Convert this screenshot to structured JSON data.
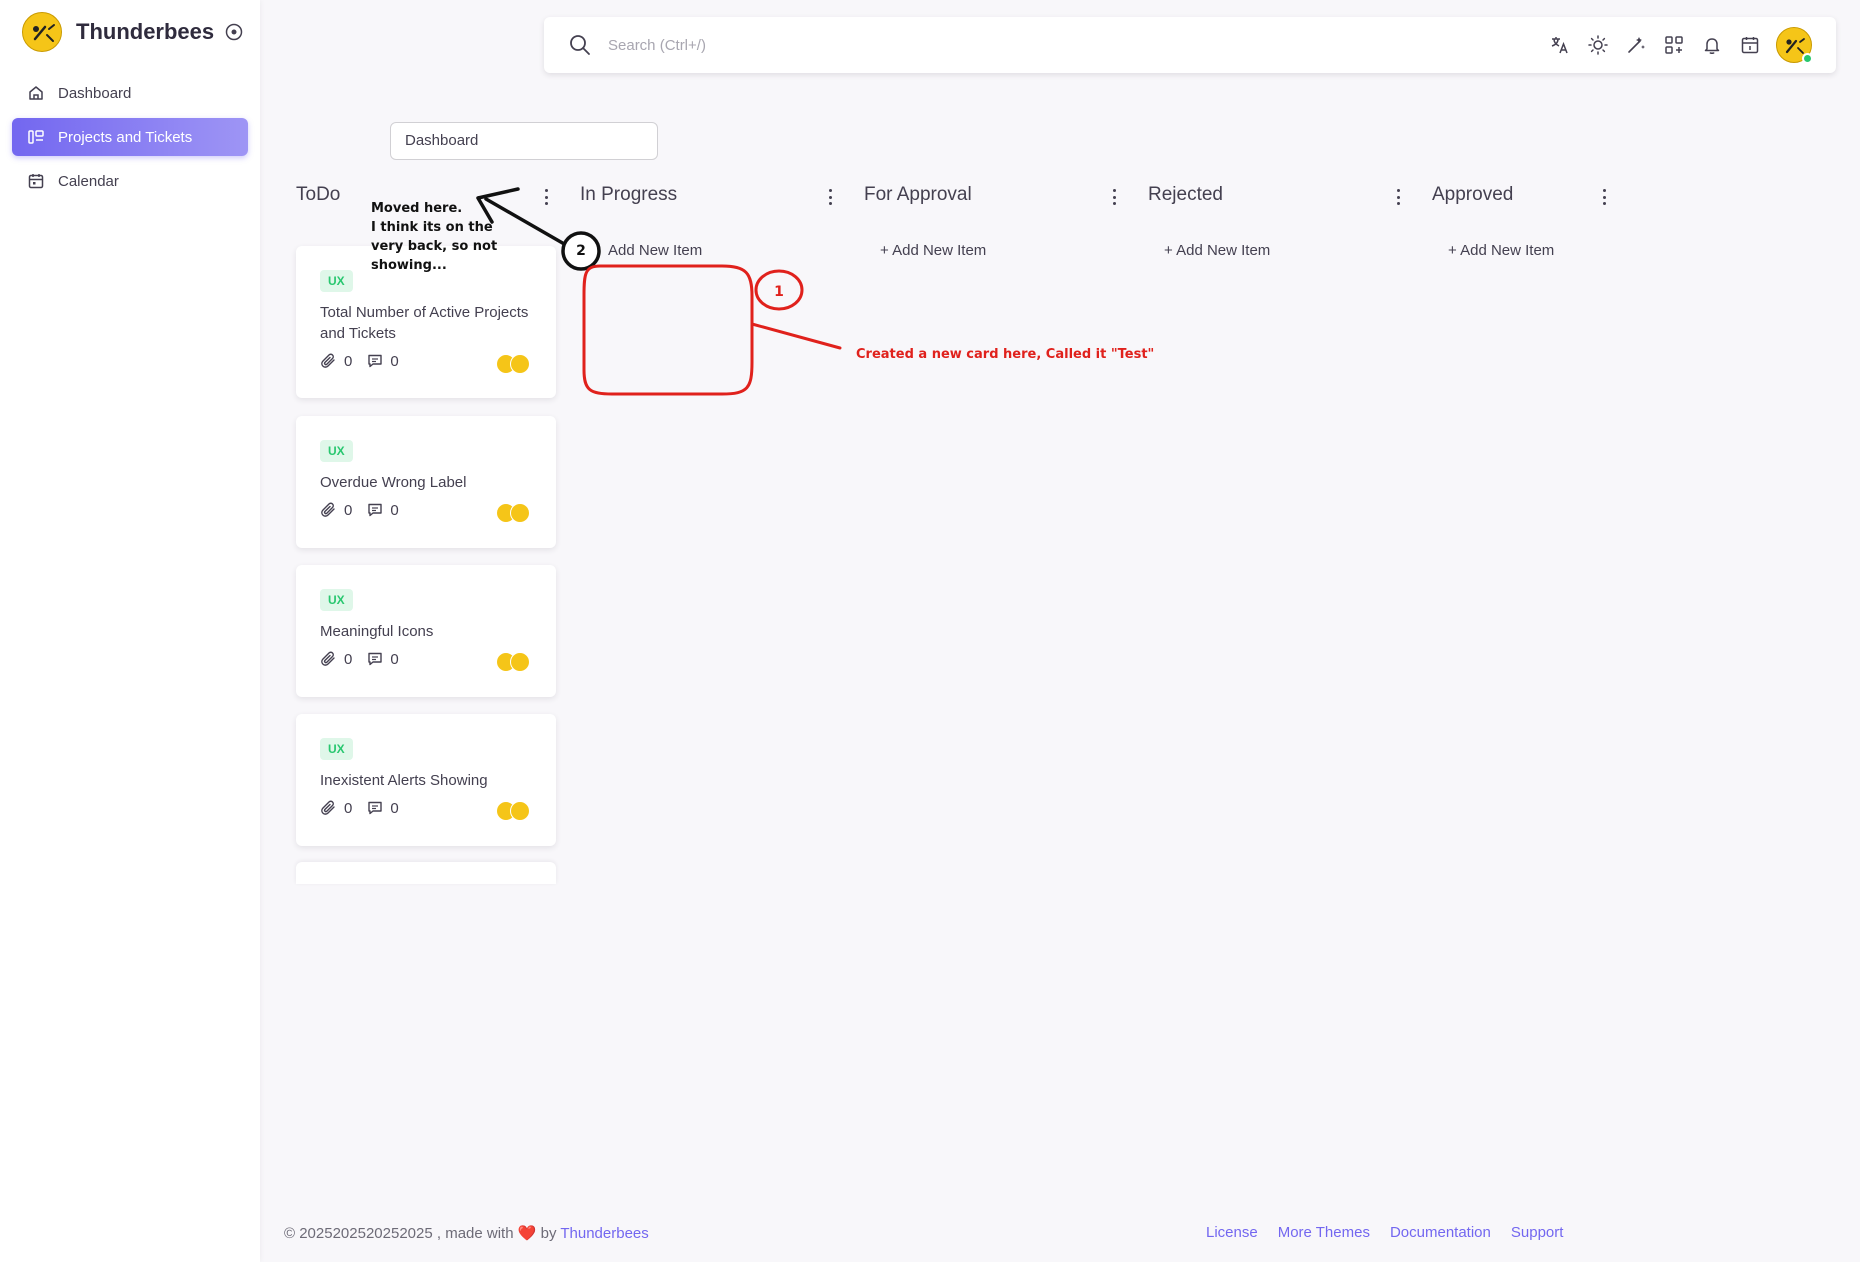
{
  "brand": {
    "name": "Thunderbees"
  },
  "sidebar": {
    "items": [
      {
        "label": "Dashboard",
        "icon": "home-icon",
        "active": false
      },
      {
        "label": "Projects and Tickets",
        "icon": "kanban-icon",
        "active": true
      },
      {
        "label": "Calendar",
        "icon": "calendar-icon",
        "active": false
      }
    ]
  },
  "topbar": {
    "search_placeholder": "Search (Ctrl+/)",
    "icons": [
      "translate-icon",
      "sun-icon",
      "magic-wand-icon",
      "apps-grid-icon",
      "bell-icon",
      "calendar-icon"
    ]
  },
  "board_select": {
    "value": "Dashboard"
  },
  "columns": [
    {
      "title": "ToDo"
    },
    {
      "title": "In Progress",
      "add_label": "Add New Item"
    },
    {
      "title": "For Approval",
      "add_label": "+ Add New Item"
    },
    {
      "title": "Rejected",
      "add_label": "+ Add New Item"
    },
    {
      "title": "Approved",
      "add_label": "+ Add New Item"
    }
  ],
  "cards": [
    {
      "badge": "UX",
      "title": "Total Number of Active Projects and Tickets",
      "attachments": "0",
      "comments": "0"
    },
    {
      "badge": "UX",
      "title": "Overdue Wrong Label",
      "attachments": "0",
      "comments": "0"
    },
    {
      "badge": "UX",
      "title": "Meaningful Icons",
      "attachments": "0",
      "comments": "0"
    },
    {
      "badge": "UX",
      "title": "Inexistent Alerts Showing",
      "attachments": "0",
      "comments": "0"
    }
  ],
  "annotations": {
    "marker_1": "1",
    "marker_2": "2",
    "note_black": "Moved here.\nI think its on the very back, so not showing...",
    "note_red": "Created a new card here, Called it \"Test\""
  },
  "footer": {
    "copyright": "© 2025202520252025 , made with",
    "by": "by",
    "brand_link": "Thunderbees",
    "links": [
      "License",
      "More Themes",
      "Documentation",
      "Support"
    ]
  },
  "colors": {
    "primary": "#7367f0",
    "badge_bg": "#dff7e9",
    "badge_text": "#28c76f",
    "annotation_red": "#e0211c",
    "online": "#28c76f"
  }
}
